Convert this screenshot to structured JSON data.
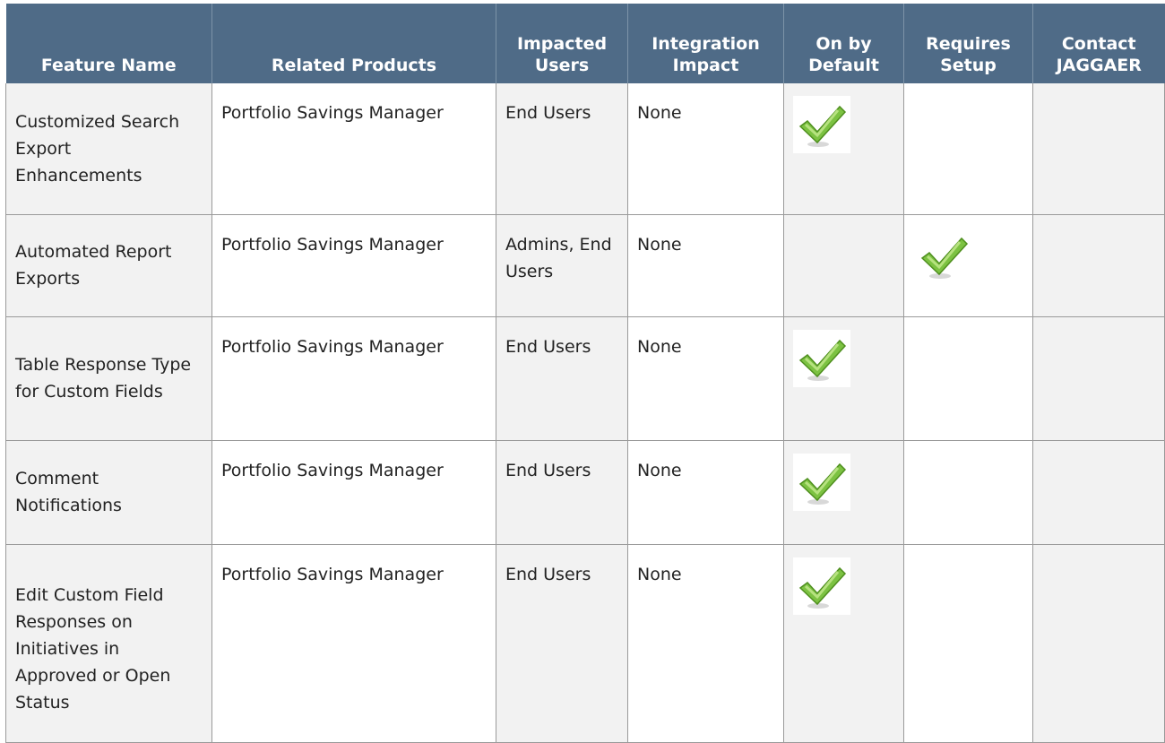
{
  "headers": {
    "feature_name": "Feature Name",
    "related_products": "Related Products",
    "impacted_users": "Impacted Users",
    "integration_impact": "Integration Impact",
    "on_by_default": "On by Default",
    "requires_setup": "Requires Setup",
    "contact_jaggaer": "Contact JAGGAER"
  },
  "rows": [
    {
      "feature_name": "Customized Search Export Enhancements",
      "related_products": "Portfolio Savings Manager",
      "impacted_users": "End Users",
      "integration_impact": "None",
      "on_by_default": true,
      "requires_setup": false,
      "contact_jaggaer": false
    },
    {
      "feature_name": "Automated Report Exports",
      "related_products": "Portfolio Savings Manager",
      "impacted_users": "Admins, End Users",
      "integration_impact": "None",
      "on_by_default": false,
      "requires_setup": true,
      "contact_jaggaer": false
    },
    {
      "feature_name": "Table Response Type for Custom Fields",
      "related_products": "Portfolio Savings Manager",
      "impacted_users": "End Users",
      "integration_impact": "None",
      "on_by_default": true,
      "requires_setup": false,
      "contact_jaggaer": false
    },
    {
      "feature_name": "Comment Notifications",
      "related_products": "Portfolio Savings Manager",
      "impacted_users": "End Users",
      "integration_impact": "None",
      "on_by_default": true,
      "requires_setup": false,
      "contact_jaggaer": false
    },
    {
      "feature_name": "Edit Custom Field Responses on Initiatives in Approved or Open Status",
      "related_products": "Portfolio Savings Manager",
      "impacted_users": "End Users",
      "integration_impact": "None",
      "on_by_default": true,
      "requires_setup": false,
      "contact_jaggaer": false
    }
  ],
  "icons": {
    "checkmark": "checkmark-icon"
  },
  "colors": {
    "header_bg": "#4f6b87",
    "header_text": "#ffffff",
    "cell_gray": "#f2f2f2",
    "check_green": "#7cc242"
  }
}
